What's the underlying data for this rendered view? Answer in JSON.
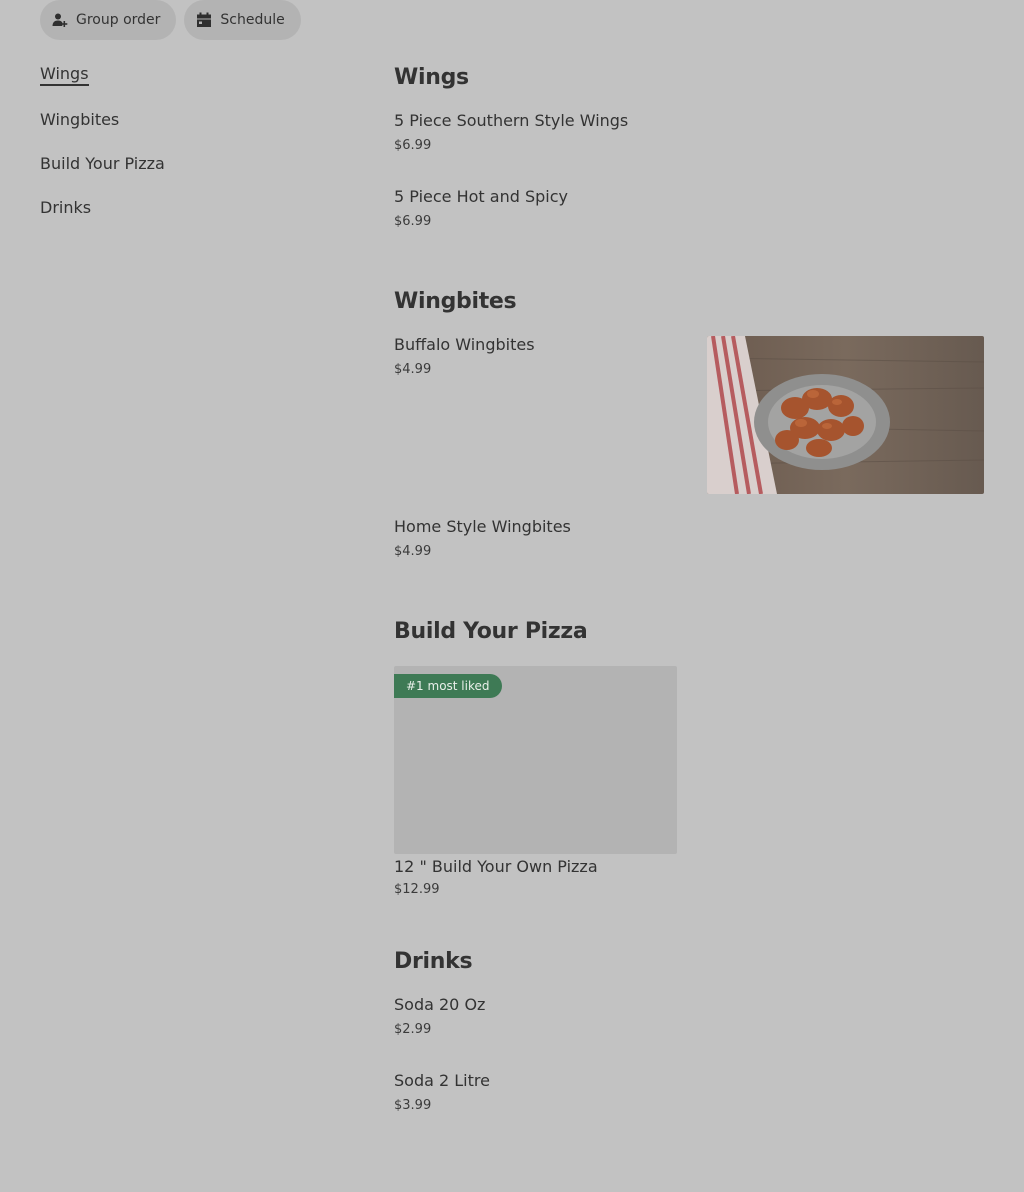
{
  "top_actions": {
    "group_order_label": "Group order",
    "schedule_label": "Schedule"
  },
  "sidebar": {
    "items": [
      {
        "label": "Wings",
        "active": true
      },
      {
        "label": "Wingbites",
        "active": false
      },
      {
        "label": "Build Your Pizza",
        "active": false
      },
      {
        "label": "Drinks",
        "active": false
      }
    ]
  },
  "menu": {
    "sections": [
      {
        "title": "Wings",
        "items": [
          {
            "name": "5 Piece Southern Style Wings",
            "price": "$6.99"
          },
          {
            "name": "5 Piece Hot and Spicy",
            "price": "$6.99"
          }
        ]
      },
      {
        "title": "Wingbites",
        "items": [
          {
            "name": "Buffalo Wingbites",
            "price": "$4.99"
          },
          {
            "name": "Home Style Wingbites",
            "price": "$4.99"
          }
        ]
      },
      {
        "title": "Build Your Pizza",
        "items": [
          {
            "name": "12 \" Build Your Own Pizza",
            "price": "$12.99",
            "badge": "#1 most liked"
          }
        ]
      },
      {
        "title": "Drinks",
        "items": [
          {
            "name": "Soda 20 Oz",
            "price": "$2.99"
          },
          {
            "name": "Soda 2 Litre",
            "price": "$3.99"
          }
        ]
      }
    ]
  },
  "icons": {
    "group_order": "person-add-icon",
    "schedule": "calendar-icon"
  },
  "colors": {
    "page_background": "#c2c2c2",
    "pill_background": "#b3b3b3",
    "badge_background": "#3e7a55"
  }
}
